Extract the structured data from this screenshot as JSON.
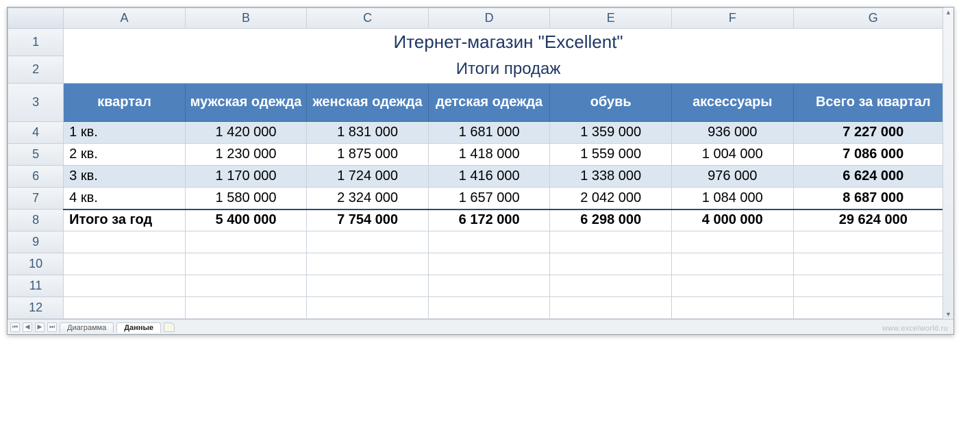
{
  "columns": [
    "A",
    "B",
    "C",
    "D",
    "E",
    "F",
    "G"
  ],
  "row_numbers": [
    1,
    2,
    3,
    4,
    5,
    6,
    7,
    8,
    9,
    10,
    11,
    12
  ],
  "title": "Итернет-магазин \"Excellent\"",
  "subtitle": "Итоги продаж",
  "headers": {
    "col_A": "квартал",
    "col_B": "мужская одежда",
    "col_C": "женская одежда",
    "col_D": "детская одежда",
    "col_E": "обувь",
    "col_F": "аксессуары",
    "col_G": "Всего за квартал"
  },
  "chart_data": {
    "type": "table",
    "title": "Итернет-магазин \"Excellent\" — Итоги продаж",
    "columns": [
      "квартал",
      "мужская одежда",
      "женская одежда",
      "детская одежда",
      "обувь",
      "аксессуары",
      "Всего за квартал"
    ],
    "rows": [
      {
        "label": "1 кв.",
        "values": [
          1420000,
          1831000,
          1681000,
          1359000,
          936000,
          7227000
        ]
      },
      {
        "label": "2 кв.",
        "values": [
          1230000,
          1875000,
          1418000,
          1559000,
          1004000,
          7086000
        ]
      },
      {
        "label": "3 кв.",
        "values": [
          1170000,
          1724000,
          1416000,
          1338000,
          976000,
          6624000
        ]
      },
      {
        "label": "4 кв.",
        "values": [
          1580000,
          2324000,
          1657000,
          2042000,
          1084000,
          8687000
        ]
      }
    ],
    "totals": {
      "label": "Итого за год",
      "values": [
        5400000,
        7754000,
        6172000,
        6298000,
        4000000,
        29624000
      ]
    }
  },
  "data_rows": [
    {
      "label": "1 кв.",
      "B": "1 420 000",
      "C": "1 831 000",
      "D": "1 681 000",
      "E": "1 359 000",
      "F": "936 000",
      "G": "7 227 000"
    },
    {
      "label": "2 кв.",
      "B": "1 230 000",
      "C": "1 875 000",
      "D": "1 418 000",
      "E": "1 559 000",
      "F": "1 004 000",
      "G": "7 086 000"
    },
    {
      "label": "3 кв.",
      "B": "1 170 000",
      "C": "1 724 000",
      "D": "1 416 000",
      "E": "1 338 000",
      "F": "976 000",
      "G": "6 624 000"
    },
    {
      "label": "4 кв.",
      "B": "1 580 000",
      "C": "2 324 000",
      "D": "1 657 000",
      "E": "2 042 000",
      "F": "1 084 000",
      "G": "8 687 000"
    }
  ],
  "footer_row": {
    "label": "Итого за год",
    "B": "5 400 000",
    "C": "7 754 000",
    "D": "6 172 000",
    "E": "6 298 000",
    "F": "4 000 000",
    "G": "29 624 000"
  },
  "tabs": [
    {
      "label": "Диаграмма",
      "active": false
    },
    {
      "label": "Данные",
      "active": true
    }
  ],
  "watermark": "www.excelworld.ru"
}
